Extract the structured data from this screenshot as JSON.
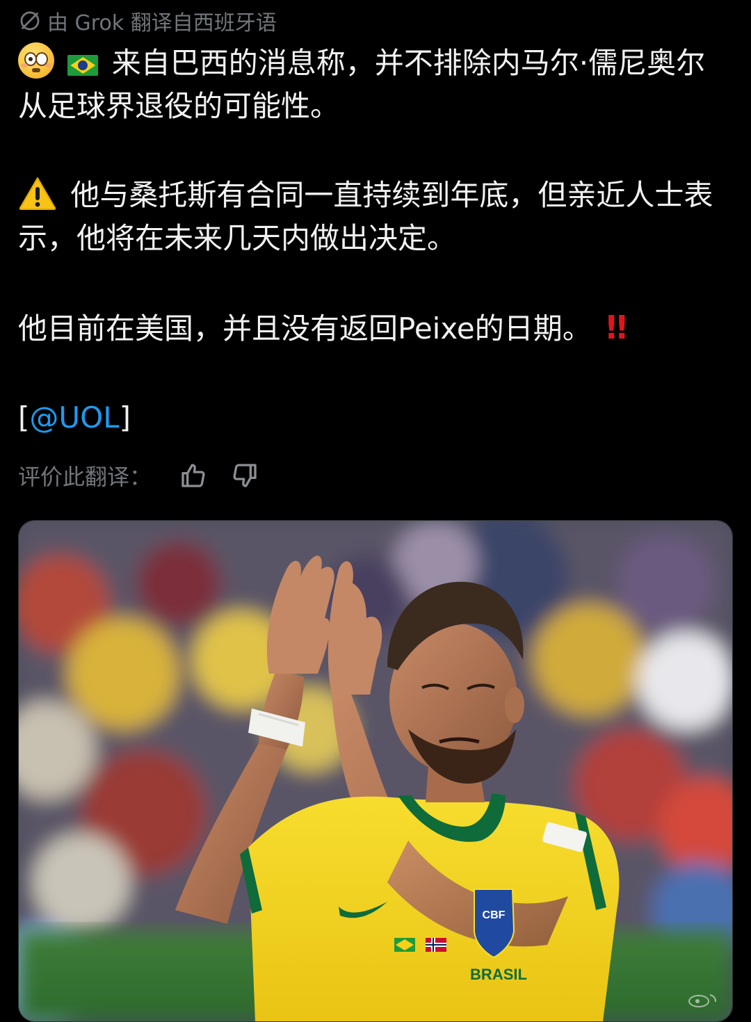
{
  "translation_header": {
    "label": "由 Grok 翻译自西班牙语",
    "icon": "globe-slash-icon"
  },
  "post": {
    "paragraph1": {
      "emoji1": "flushed-face-emoji",
      "emoji2": "brazil-flag-emoji",
      "text": "来自巴西的消息称，并不排除内马尔·儒尼奥尔从足球界退役的可能性。"
    },
    "paragraph2": {
      "emoji": "warning-emoji",
      "text": "他与桑托斯有合同一直持续到年底，但亲近人士表示，他将在未来几天内做出决定。"
    },
    "paragraph3": {
      "text": "他目前在美国，并且没有返回Peixe的日期。",
      "emoji": "!!"
    },
    "paragraph4": {
      "open_bracket": "[",
      "mention": "@UOL",
      "close_bracket": "]"
    }
  },
  "rating": {
    "label": "评价此翻译：",
    "thumbs_up_icon": "thumbs-up-icon",
    "thumbs_down_icon": "thumbs-down-icon"
  },
  "media": {
    "image_subject": "Football player in yellow Brazil jersey applauding in stadium",
    "jersey_text": "BRASIL",
    "crest_text": "CBF"
  },
  "colors": {
    "background": "#000000",
    "text": "#f2f2f2",
    "muted": "#71767b",
    "link": "#1d9bf0",
    "jersey_yellow": "#f5d51f",
    "jersey_green": "#0f6b3a"
  }
}
